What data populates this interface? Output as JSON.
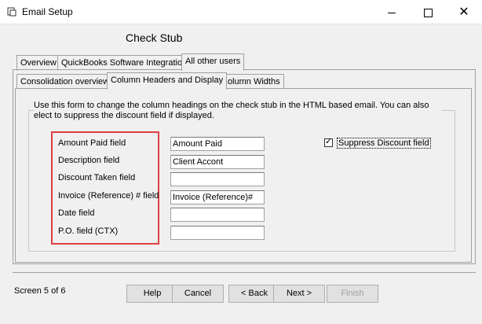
{
  "window": {
    "title": "Email Setup",
    "close_glyph": "✕"
  },
  "page": {
    "title": "Check Stub"
  },
  "tabs_row1": [
    {
      "label": "Overview"
    },
    {
      "label": "QuickBooks Software Integration"
    },
    {
      "label": "All other users"
    }
  ],
  "tabs_row2": [
    {
      "label": "Consolidation overview"
    },
    {
      "label": "Column Headers and Display"
    },
    {
      "label": "Column Widths"
    }
  ],
  "description": "Use this form to change the column headings on the check stub in the HTML based email.  You can also elect to suppress the discount field if displayed.",
  "fields": [
    {
      "label": "Amount Paid field",
      "value": "Amount Paid"
    },
    {
      "label": "Description field",
      "value": "Client Accont"
    },
    {
      "label": "Discount Taken field",
      "value": ""
    },
    {
      "label": "Invoice (Reference) # field",
      "value": "Invoice (Reference)#"
    },
    {
      "label": "Date field",
      "value": ""
    },
    {
      "label": "P.O. field (CTX)",
      "value": ""
    }
  ],
  "suppress": {
    "label": "Suppress Discount field",
    "checked": true,
    "mark": "✓"
  },
  "footer": {
    "screen_info": "Screen 5 of 6",
    "buttons": {
      "help": "Help",
      "cancel": "Cancel",
      "back": "< Back",
      "next": "Next >",
      "finish": "Finish"
    }
  },
  "colors": {
    "highlight": "#e04040",
    "background": "#f0f0f0"
  }
}
